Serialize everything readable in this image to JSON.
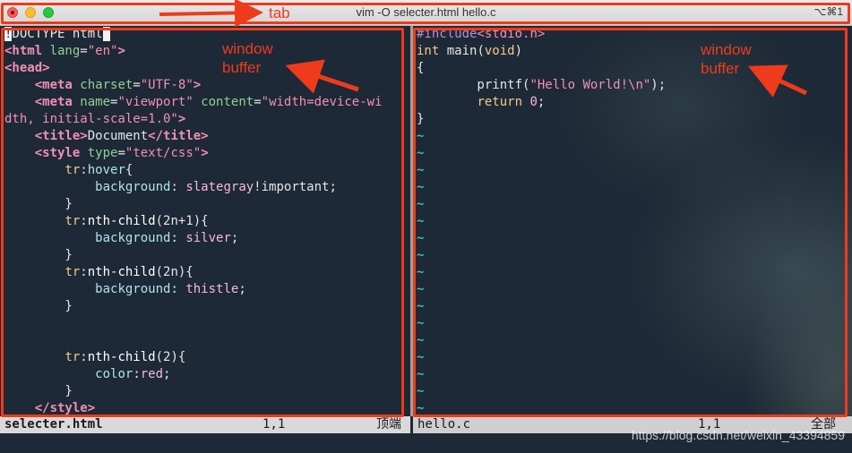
{
  "window": {
    "title": "vim -O selecter.html hello.c",
    "shortcut": "⌥⌘1"
  },
  "left_pane": {
    "lines": [
      [
        [
          "cursor",
          "!"
        ],
        [
          "c-plain",
          "DOCTYPE html"
        ],
        [
          "cursor",
          " "
        ]
      ],
      [
        [
          "c-tag",
          "<html "
        ],
        [
          "c-attr",
          "lang"
        ],
        [
          "c-plain",
          "="
        ],
        [
          "c-str",
          "\"en\""
        ],
        [
          "c-tag",
          ">"
        ]
      ],
      [
        [
          "c-tag",
          "<head>"
        ]
      ],
      [
        [
          "c-plain",
          "    "
        ],
        [
          "c-tag",
          "<meta "
        ],
        [
          "c-attr",
          "charset"
        ],
        [
          "c-plain",
          "="
        ],
        [
          "c-str",
          "\"UTF-8\""
        ],
        [
          "c-tag",
          ">"
        ]
      ],
      [
        [
          "c-plain",
          "    "
        ],
        [
          "c-tag",
          "<meta "
        ],
        [
          "c-attr",
          "name"
        ],
        [
          "c-plain",
          "="
        ],
        [
          "c-str",
          "\"viewport\""
        ],
        [
          "c-plain",
          " "
        ],
        [
          "c-attr",
          "content"
        ],
        [
          "c-plain",
          "="
        ],
        [
          "c-str",
          "\"width=device-wi"
        ]
      ],
      [
        [
          "c-str",
          "dth, initial-scale=1.0\""
        ],
        [
          "c-tag",
          ">"
        ]
      ],
      [
        [
          "c-plain",
          "    "
        ],
        [
          "c-tag",
          "<title>"
        ],
        [
          "c-plain",
          "Document"
        ],
        [
          "c-tag",
          "</title>"
        ]
      ],
      [
        [
          "c-plain",
          "    "
        ],
        [
          "c-tag",
          "<style "
        ],
        [
          "c-attr",
          "type"
        ],
        [
          "c-plain",
          "="
        ],
        [
          "c-str",
          "\"text/css\""
        ],
        [
          "c-tag",
          ">"
        ]
      ],
      [
        [
          "c-plain",
          "        "
        ],
        [
          "c-kw",
          "tr"
        ],
        [
          "c-plain",
          ":"
        ],
        [
          "c-sel",
          "hover"
        ],
        [
          "c-plain",
          "{"
        ]
      ],
      [
        [
          "c-plain",
          "            "
        ],
        [
          "c-sel",
          "background"
        ],
        [
          "c-plain",
          ": "
        ],
        [
          "c-val",
          "slategray"
        ],
        [
          "c-plain",
          "!important;"
        ]
      ],
      [
        [
          "c-plain",
          "        }"
        ]
      ],
      [
        [
          "c-plain",
          "        "
        ],
        [
          "c-kw",
          "tr"
        ],
        [
          "c-plain",
          ":"
        ],
        [
          "c-fn",
          "nth-child"
        ],
        [
          "c-plain",
          "(2n+1){"
        ]
      ],
      [
        [
          "c-plain",
          "            "
        ],
        [
          "c-sel",
          "background"
        ],
        [
          "c-plain",
          ": "
        ],
        [
          "c-val",
          "silver"
        ],
        [
          "c-plain",
          ";"
        ]
      ],
      [
        [
          "c-plain",
          "        }"
        ]
      ],
      [
        [
          "c-plain",
          "        "
        ],
        [
          "c-kw",
          "tr"
        ],
        [
          "c-plain",
          ":"
        ],
        [
          "c-fn",
          "nth-child"
        ],
        [
          "c-plain",
          "(2n){"
        ]
      ],
      [
        [
          "c-plain",
          "            "
        ],
        [
          "c-sel",
          "background"
        ],
        [
          "c-plain",
          ": "
        ],
        [
          "c-val",
          "thistle"
        ],
        [
          "c-plain",
          ";"
        ]
      ],
      [
        [
          "c-plain",
          "        }"
        ]
      ],
      [
        [
          "c-plain",
          ""
        ]
      ],
      [
        [
          "c-plain",
          ""
        ]
      ],
      [
        [
          "c-plain",
          "        "
        ],
        [
          "c-kw",
          "tr"
        ],
        [
          "c-plain",
          ":"
        ],
        [
          "c-fn",
          "nth-child"
        ],
        [
          "c-plain",
          "(2){"
        ]
      ],
      [
        [
          "c-plain",
          "            "
        ],
        [
          "c-sel",
          "color"
        ],
        [
          "c-plain",
          ":"
        ],
        [
          "c-val",
          "red"
        ],
        [
          "c-plain",
          ";"
        ]
      ],
      [
        [
          "c-plain",
          "        }"
        ]
      ],
      [
        [
          "c-plain",
          "    "
        ],
        [
          "c-tag",
          "</style>"
        ]
      ]
    ]
  },
  "right_pane": {
    "lines": [
      [
        [
          "c-pre",
          "#include"
        ],
        [
          "c-str",
          "<stdio.h>"
        ]
      ],
      [
        [
          "c-kw",
          "int"
        ],
        [
          "c-plain",
          " main("
        ],
        [
          "c-kw",
          "void"
        ],
        [
          "c-plain",
          ")"
        ]
      ],
      [
        [
          "c-plain",
          "{"
        ]
      ],
      [
        [
          "c-plain",
          "        printf("
        ],
        [
          "c-str",
          "\"Hello World!\\n\""
        ],
        [
          "c-plain",
          ");"
        ]
      ],
      [
        [
          "c-plain",
          "        "
        ],
        [
          "c-kw",
          "return"
        ],
        [
          "c-plain",
          " "
        ],
        [
          "c-val",
          "0"
        ],
        [
          "c-plain",
          ";"
        ]
      ],
      [
        [
          "c-plain",
          "}"
        ]
      ]
    ],
    "tilde_count": 17,
    "tilde_char": "~"
  },
  "status_left": {
    "filename": "selecter.html",
    "position": "1,1",
    "scroll": "顶端"
  },
  "status_right": {
    "filename": "hello.c",
    "position": "1,1",
    "scroll": "全部"
  },
  "annotations": {
    "tab_label": "tab",
    "window_label_left": [
      "window",
      "buffer"
    ],
    "window_label_right": [
      "window",
      "buffer"
    ],
    "color": "#ee3b1c"
  },
  "watermark": "https://blog.csdn.net/weixin_43394859"
}
